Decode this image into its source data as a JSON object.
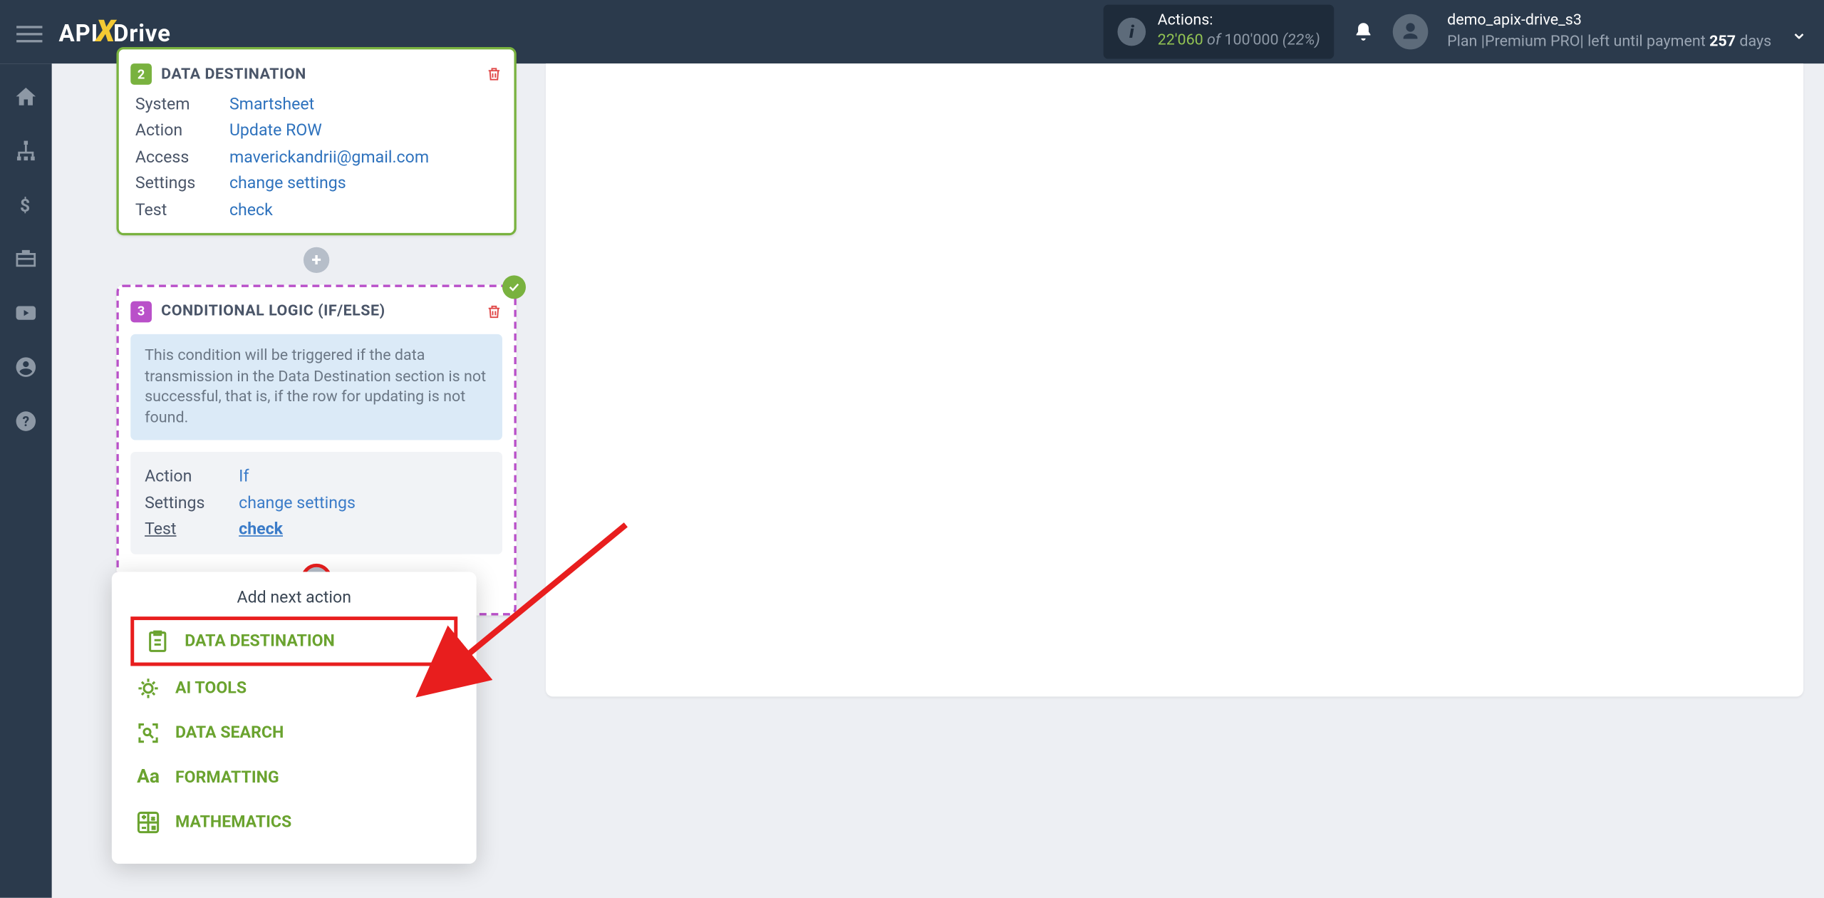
{
  "header": {
    "logo_pre": "API",
    "logo_x": "X",
    "logo_post": "Drive",
    "actions_label": "Actions:",
    "actions_count": "22'060",
    "actions_of": " of ",
    "actions_total": "100'000",
    "actions_pct": " (22%)",
    "user_name": "demo_apix-drive_s3",
    "user_plan_pre": "Plan |Premium PRO| left until payment ",
    "user_plan_days": "257",
    "user_plan_post": " days"
  },
  "card2": {
    "num": "2",
    "title": "DATA DESTINATION",
    "rows": {
      "system_l": "System",
      "system_v": "Smartsheet",
      "action_l": "Action",
      "action_v": "Update ROW",
      "access_l": "Access",
      "access_v": "maverickandrii@gmail.com",
      "settings_l": "Settings",
      "settings_v": "change settings",
      "test_l": "Test",
      "test_v": "check"
    }
  },
  "card3": {
    "num": "3",
    "title": "CONDITIONAL LOGIC (IF/ELSE)",
    "info": "This condition will be triggered if the data transmission in the Data Destination section is not successful, that is, if the row for updating is not found.",
    "rows": {
      "action_l": "Action",
      "action_v": "If",
      "settings_l": "Settings",
      "settings_v": "change settings",
      "test_l": "Test",
      "test_v": "check"
    }
  },
  "popup": {
    "title": "Add next action",
    "items": {
      "dest": "DATA DESTINATION",
      "ai": "AI TOOLS",
      "search": "DATA SEARCH",
      "format": "FORMATTING",
      "math": "MATHEMATICS"
    }
  }
}
